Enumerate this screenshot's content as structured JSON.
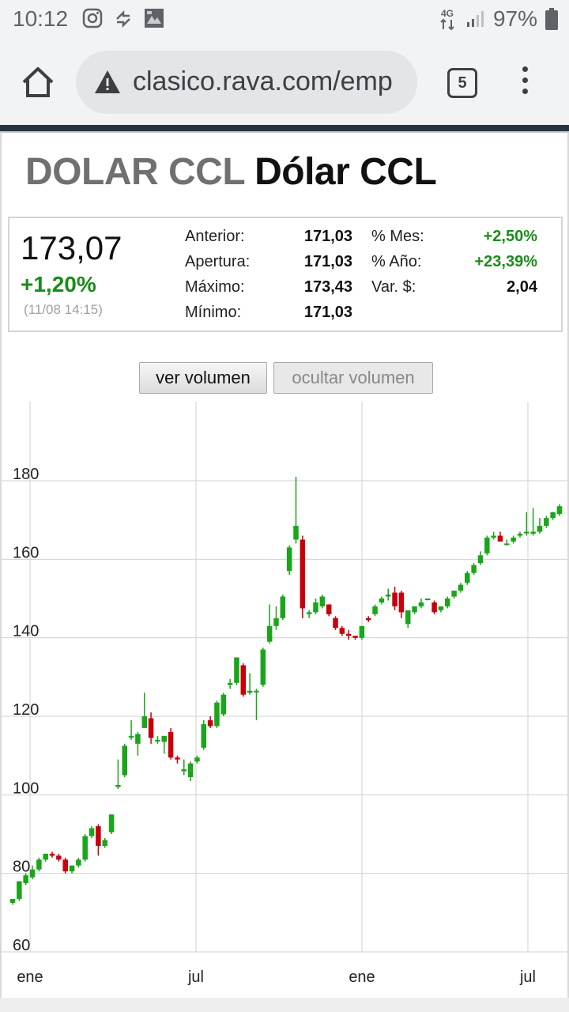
{
  "status_bar": {
    "time": "10:12",
    "icons": [
      "instagram-icon",
      "sync-icon",
      "image-icon"
    ],
    "network": "4G",
    "battery": "97%"
  },
  "browser": {
    "url": "clasico.rava.com/emp",
    "tab_count": "5"
  },
  "header": {
    "title_code": "DOLAR CCL",
    "title_name": "Dólar CCL"
  },
  "quote": {
    "price": "173,07",
    "change_pct": "+1,20%",
    "timestamp": "(11/08 14:15)",
    "stats_left": [
      {
        "label": "Anterior:",
        "value": "171,03"
      },
      {
        "label": "Apertura:",
        "value": "171,03"
      },
      {
        "label": "Máximo:",
        "value": "173,43"
      },
      {
        "label": "Mínimo:",
        "value": "171,03"
      }
    ],
    "stats_right": [
      {
        "label": "% Mes:",
        "value": "+2,50%"
      },
      {
        "label": "% Año:",
        "value": "+23,39%"
      },
      {
        "label": "Var. $:",
        "value": "2,04"
      }
    ]
  },
  "buttons": {
    "show_volume": "ver volumen",
    "hide_volume": "ocultar volumen"
  },
  "chart_data": {
    "type": "candlestick",
    "y_ticks": [
      "180",
      "160",
      "140",
      "120",
      "100",
      "80",
      "60"
    ],
    "x_ticks": [
      "ene",
      "jul",
      "ene",
      "jul"
    ],
    "ylim": [
      60,
      180
    ],
    "grid": true,
    "colors": {
      "up": "#1aa51a",
      "down": "#c8000a",
      "grid": "#d0d0d0"
    },
    "candles": [
      [
        72.5,
        73.5,
        72,
        73.5
      ],
      [
        73.5,
        78,
        73,
        78
      ],
      [
        77.5,
        80,
        77,
        79.5
      ],
      [
        79,
        82,
        78.5,
        81
      ],
      [
        81,
        84,
        80.5,
        83.5
      ],
      [
        83.5,
        85,
        83,
        85
      ],
      [
        85,
        85.5,
        84,
        84.5
      ],
      [
        84.5,
        85,
        83,
        83.5
      ],
      [
        83.5,
        84,
        80,
        80.5
      ],
      [
        80.5,
        82,
        80,
        82
      ],
      [
        82,
        84,
        81.5,
        83.5
      ],
      [
        83.5,
        90,
        83,
        89.5
      ],
      [
        89.5,
        92,
        89,
        91.5
      ],
      [
        92,
        92.5,
        84.5,
        87
      ],
      [
        87,
        89,
        86.5,
        88.5
      ],
      [
        90.5,
        95,
        90,
        95
      ],
      [
        102,
        109,
        101.5,
        102.5
      ],
      [
        105,
        113,
        104.5,
        112.5
      ],
      [
        115,
        119,
        114,
        115
      ],
      [
        113,
        116,
        110,
        115.5
      ],
      [
        117,
        126,
        117,
        120
      ],
      [
        119.5,
        121,
        113,
        114.5
      ],
      [
        114,
        115,
        113,
        114
      ],
      [
        113.5,
        115,
        110.5,
        115
      ],
      [
        116,
        117,
        109,
        109.5
      ],
      [
        109.5,
        110,
        108,
        109
      ],
      [
        106,
        109,
        105,
        106.5
      ],
      [
        104.5,
        108.5,
        103.5,
        108
      ],
      [
        108.5,
        110,
        108,
        109.5
      ],
      [
        112,
        119,
        111.5,
        118
      ],
      [
        119,
        120,
        117,
        117.5
      ],
      [
        117.5,
        124,
        117,
        123.5
      ],
      [
        120.5,
        126,
        120,
        125.5
      ],
      [
        128,
        129.5,
        127,
        128.5
      ],
      [
        128.5,
        135,
        128,
        135
      ],
      [
        133,
        133.5,
        125,
        125.5
      ],
      [
        126,
        131,
        125.5,
        126.5
      ],
      [
        126.5,
        127,
        119,
        126.5
      ],
      [
        128,
        137.5,
        127.5,
        137
      ],
      [
        139,
        148.5,
        138.5,
        143
      ],
      [
        143,
        148,
        142,
        145
      ],
      [
        145,
        151,
        144.5,
        150.5
      ],
      [
        157,
        163.5,
        156,
        163
      ],
      [
        165,
        181,
        164,
        168.5
      ],
      [
        165,
        166,
        145,
        147.5
      ],
      [
        146,
        147,
        145,
        146.5
      ],
      [
        146.5,
        150,
        146,
        149
      ],
      [
        148,
        151,
        147.5,
        150.5
      ],
      [
        148.5,
        148.5,
        145.5,
        146
      ],
      [
        145,
        145.5,
        142,
        142.5
      ],
      [
        142.5,
        143,
        140.5,
        141
      ],
      [
        141,
        142,
        139.5,
        140.5
      ],
      [
        140.5,
        140.5,
        139.5,
        140
      ],
      [
        140,
        143,
        139.5,
        143
      ],
      [
        145,
        145.5,
        144,
        144.5
      ],
      [
        146,
        148.5,
        145.5,
        148
      ],
      [
        149,
        150.5,
        148.5,
        150
      ],
      [
        150.5,
        152.5,
        149.5,
        151
      ],
      [
        151.5,
        153,
        147,
        148
      ],
      [
        151.5,
        152,
        145,
        146.5
      ],
      [
        143.5,
        147,
        142.5,
        147
      ],
      [
        146.5,
        148,
        146,
        148
      ],
      [
        148,
        150,
        147.5,
        149
      ],
      [
        150,
        150,
        149.5,
        150
      ],
      [
        149,
        149.5,
        146,
        146.5
      ],
      [
        147,
        148,
        146.5,
        148
      ],
      [
        148,
        150.5,
        147.5,
        150
      ],
      [
        150.5,
        152,
        150,
        152
      ],
      [
        152,
        154,
        151.5,
        153.5
      ],
      [
        154,
        157,
        153.5,
        156.5
      ],
      [
        156.5,
        159,
        156,
        158.5
      ],
      [
        159,
        162,
        158.5,
        161
      ],
      [
        161.5,
        166,
        161,
        165.5
      ],
      [
        165.5,
        167,
        165,
        166
      ],
      [
        166,
        167,
        164.5,
        164.5
      ],
      [
        164,
        165,
        163.5,
        164
      ],
      [
        164.5,
        166,
        164,
        165.5
      ],
      [
        166,
        167,
        165.5,
        166.5
      ],
      [
        167,
        172,
        166,
        167
      ],
      [
        166.5,
        173,
        166,
        167
      ],
      [
        167,
        170.5,
        166.5,
        168.5
      ],
      [
        168.5,
        171,
        168,
        170.5
      ],
      [
        170.5,
        172,
        170,
        172
      ],
      [
        171.5,
        174,
        171,
        173.5
      ]
    ]
  }
}
